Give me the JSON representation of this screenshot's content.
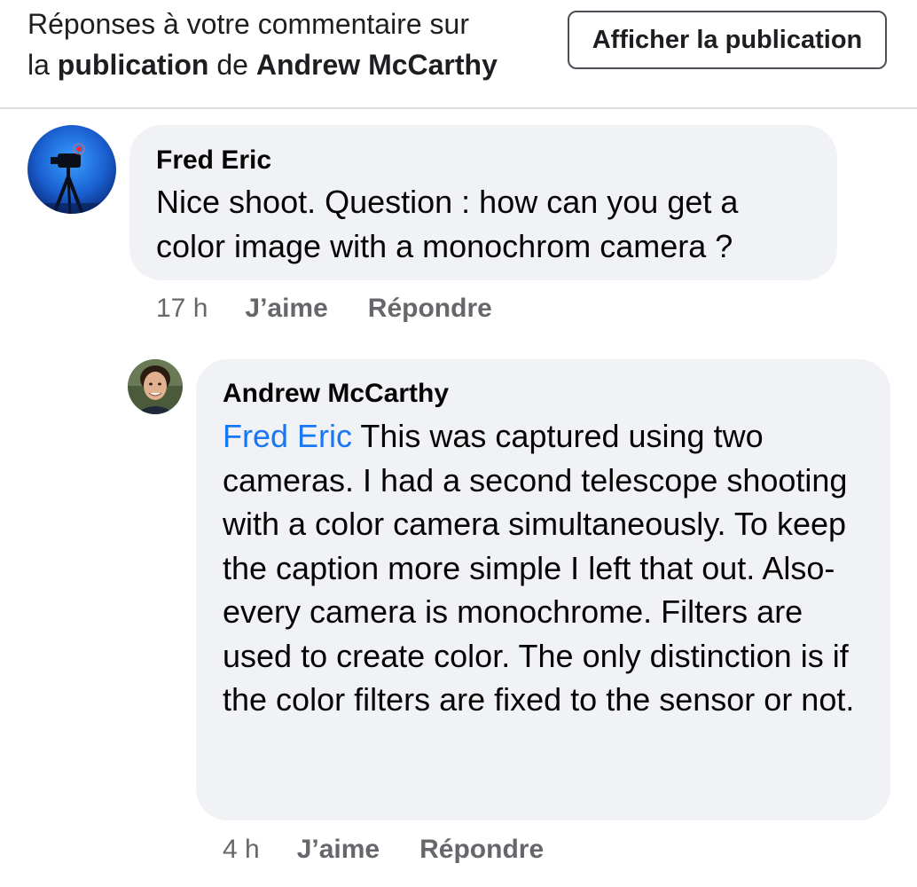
{
  "header": {
    "title_line1": "Réponses à votre commentaire sur",
    "title_prefix": "la ",
    "title_post_word": "publication",
    "title_de": " de ",
    "title_author": "Andrew McCarthy",
    "view_post_label": "Afficher la publication"
  },
  "comments": [
    {
      "author": "Fred Eric",
      "text": "Nice shoot. Question : how can you get a color image with a monochrom camera ?",
      "time": "17 h",
      "like_label": "J’aime",
      "reply_label": "Répondre"
    },
    {
      "author": "Andrew McCarthy",
      "mention": "Fred Eric",
      "text": " This was captured using two cameras. I had a second telescope shooting with a color camera simultaneously. To keep the caption more simple I left that out. Also- every camera is monochrome. Filters are used to create color. The only distinction is if the color filters are fixed to the sensor or not.",
      "time": "4 h",
      "like_label": "J’aime",
      "reply_label": "Répondre"
    }
  ],
  "colors": {
    "mention": "#1877f2",
    "bubble": "#f0f2f5",
    "meta_text": "#65676b"
  },
  "icons": {
    "fred_avatar": "telescope-night-photo",
    "andrew_avatar": "profile-photo"
  }
}
